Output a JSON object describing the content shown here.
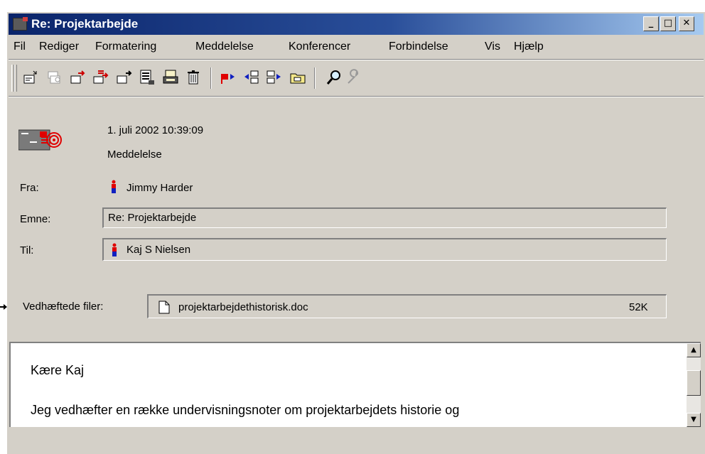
{
  "window": {
    "title": "Re: Projektarbejde"
  },
  "title_buttons": {
    "minimize": "_",
    "maximize": "□",
    "close": "✕"
  },
  "menu": [
    "Fil",
    "Rediger",
    "Formatering",
    "Meddelelse",
    "Konferencer",
    "Forbindelse",
    "Vis",
    "Hjælp"
  ],
  "toolbar_icons": [
    "reply-icon",
    "reply-all-icon",
    "forward-icon",
    "forward-all-icon",
    "new-message-icon",
    "print-preview-icon",
    "print-icon",
    "delete-icon",
    "flag-icon",
    "previous-message-icon",
    "next-message-icon",
    "folder-icon",
    "search-icon",
    "settings-icon"
  ],
  "header": {
    "date": "1. juli 2002 10:39:09",
    "type": "Meddelelse",
    "from_label": "Fra:",
    "from_value": "Jimmy Harder",
    "subject_label": "Emne:",
    "subject_value": "Re: Projektarbejde",
    "to_label": "Til:",
    "to_value": "Kaj S Nielsen",
    "attachments_label": "Vedhæftede filer:",
    "attachment_name": "projektarbejdethistorisk.doc",
    "attachment_size": "52K"
  },
  "body": {
    "line1": "Kære Kaj",
    "line2": "Jeg vedhæfter en række undervisningsnoter om projektarbejdets historie og"
  },
  "colors": {
    "titlebar_start": "#0a246a",
    "titlebar_end": "#a6caf0",
    "face": "#d4d0c8",
    "accent_red": "#e00000"
  }
}
